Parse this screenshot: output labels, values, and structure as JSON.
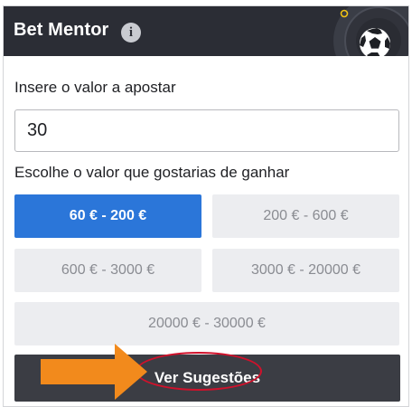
{
  "header": {
    "title": "Bet Mentor",
    "info_glyph": "i",
    "info_icon": "info-icon",
    "decoration_icon": "soccer-ball-icon",
    "bg_color": "#2b2d35"
  },
  "form": {
    "stake_label": "Insere o valor a apostar",
    "stake_value": "30",
    "target_label": "Escolhe o valor que gostarias de ganhar",
    "ranges": [
      {
        "label": "60 € - 200 €",
        "selected": true
      },
      {
        "label": "200 € - 600 €",
        "selected": false
      },
      {
        "label": "600 € - 3000 €",
        "selected": false
      },
      {
        "label": "3000 € - 20000 €",
        "selected": false
      },
      {
        "label": "20000 € - 30000 €",
        "selected": false
      }
    ],
    "submit_label": "Ver Sugestões"
  },
  "colors": {
    "accent": "#2b76d9",
    "option_bg": "#ecedf0",
    "cta_bg": "#3b3d44",
    "annotation_arrow": "#f28a1c",
    "annotation_circle": "#d0112b"
  }
}
